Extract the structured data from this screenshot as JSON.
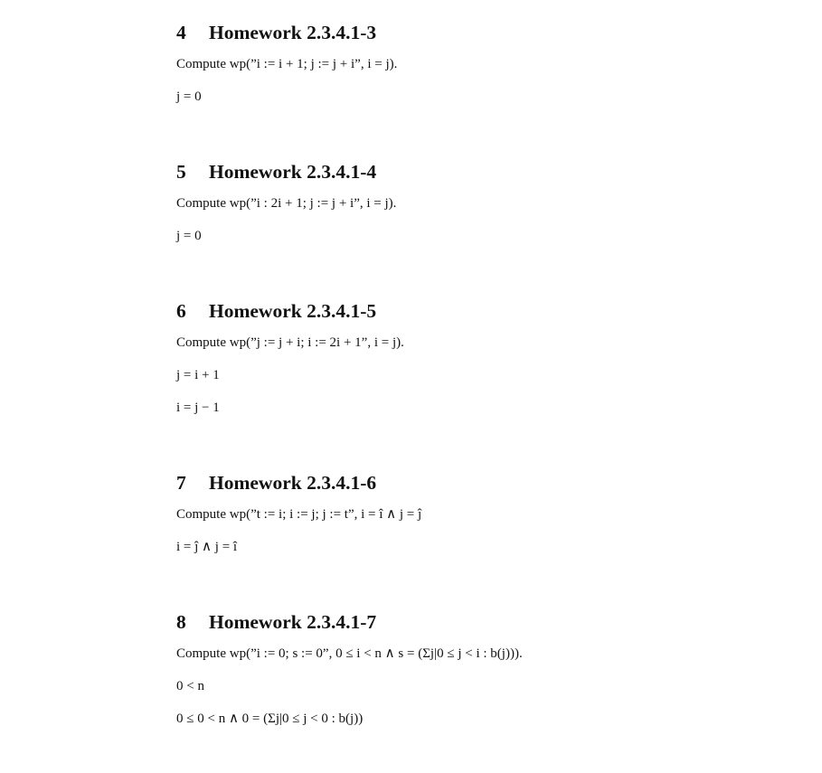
{
  "sections": [
    {
      "number": "4",
      "title": "Homework 2.3.4.1-3",
      "prompt": "Compute wp(”i := i + 1; j := j + i”, i = j).",
      "lines": [
        "j = 0"
      ]
    },
    {
      "number": "5",
      "title": "Homework 2.3.4.1-4",
      "prompt": "Compute wp(”i : 2i + 1; j := j + i”, i = j).",
      "lines": [
        "j = 0"
      ]
    },
    {
      "number": "6",
      "title": "Homework 2.3.4.1-5",
      "prompt": "Compute wp(”j := j + i; i := 2i + 1”, i = j).",
      "lines": [
        "j = i + 1",
        "i = j − 1"
      ]
    },
    {
      "number": "7",
      "title": "Homework 2.3.4.1-6",
      "prompt": "Compute wp(”t := i; i := j; j := t”, i = î ∧ j = ĵ",
      "lines": [
        "i = ĵ ∧ j = î"
      ]
    },
    {
      "number": "8",
      "title": "Homework 2.3.4.1-7",
      "prompt": "Compute wp(”i := 0; s := 0”, 0 ≤ i < n ∧ s = (Σj|0 ≤ j < i : b(j))).",
      "lines": [
        "0 < n",
        "0 ≤ 0 < n ∧ 0 = (Σj|0 ≤ j < 0 : b(j))"
      ]
    }
  ]
}
